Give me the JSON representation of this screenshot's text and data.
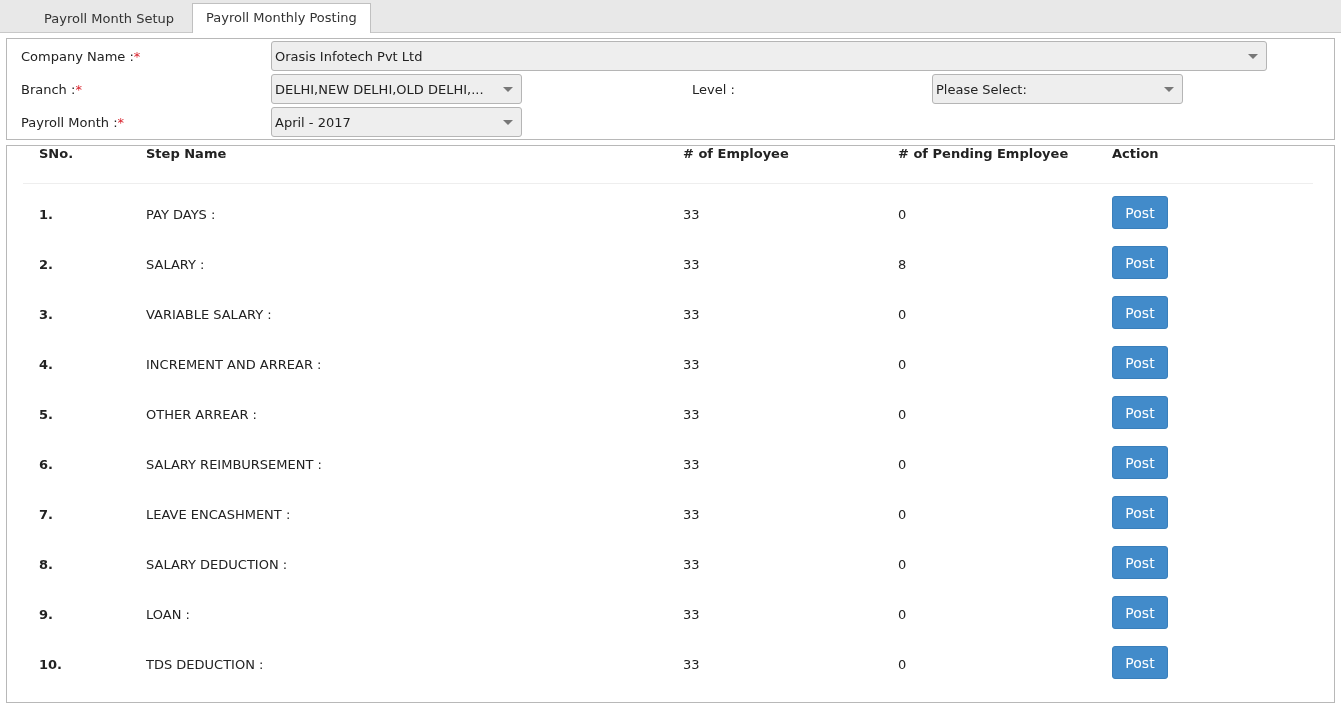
{
  "tabs": [
    {
      "label": "Payroll Month Setup",
      "selected": false
    },
    {
      "label": "Payroll Monthly Posting",
      "selected": true
    }
  ],
  "form": {
    "company": {
      "label": "Company Name :",
      "required_mark": "*",
      "value": "Orasis Infotech Pvt Ltd"
    },
    "branch": {
      "label": "Branch :",
      "required_mark": "*",
      "value": "DELHI,NEW DELHI,OLD DELHI,..."
    },
    "level": {
      "label": "Level :",
      "value": "Please Select:"
    },
    "payroll_month": {
      "label": "Payroll Month :",
      "required_mark": "*",
      "value": "April - 2017"
    }
  },
  "table": {
    "columns": [
      "SNo.",
      "Step Name",
      "# of Employee",
      "# of Pending Employee",
      "Action"
    ],
    "rows": [
      {
        "sno": "1.",
        "step": "PAY DAYS :",
        "employees": "33",
        "pending": "0",
        "action": "Post"
      },
      {
        "sno": "2.",
        "step": "SALARY :",
        "employees": "33",
        "pending": "8",
        "action": "Post"
      },
      {
        "sno": "3.",
        "step": "VARIABLE SALARY :",
        "employees": "33",
        "pending": "0",
        "action": "Post"
      },
      {
        "sno": "4.",
        "step": "INCREMENT AND ARREAR :",
        "employees": "33",
        "pending": "0",
        "action": "Post"
      },
      {
        "sno": "5.",
        "step": "OTHER ARREAR :",
        "employees": "33",
        "pending": "0",
        "action": "Post"
      },
      {
        "sno": "6.",
        "step": "SALARY REIMBURSEMENT :",
        "employees": "33",
        "pending": "0",
        "action": "Post"
      },
      {
        "sno": "7.",
        "step": "LEAVE ENCASHMENT :",
        "employees": "33",
        "pending": "0",
        "action": "Post"
      },
      {
        "sno": "8.",
        "step": "SALARY DEDUCTION :",
        "employees": "33",
        "pending": "0",
        "action": "Post"
      },
      {
        "sno": "9.",
        "step": "LOAN :",
        "employees": "33",
        "pending": "0",
        "action": "Post"
      },
      {
        "sno": "10.",
        "step": "TDS DEDUCTION :",
        "employees": "33",
        "pending": "0",
        "action": "Post"
      }
    ]
  }
}
